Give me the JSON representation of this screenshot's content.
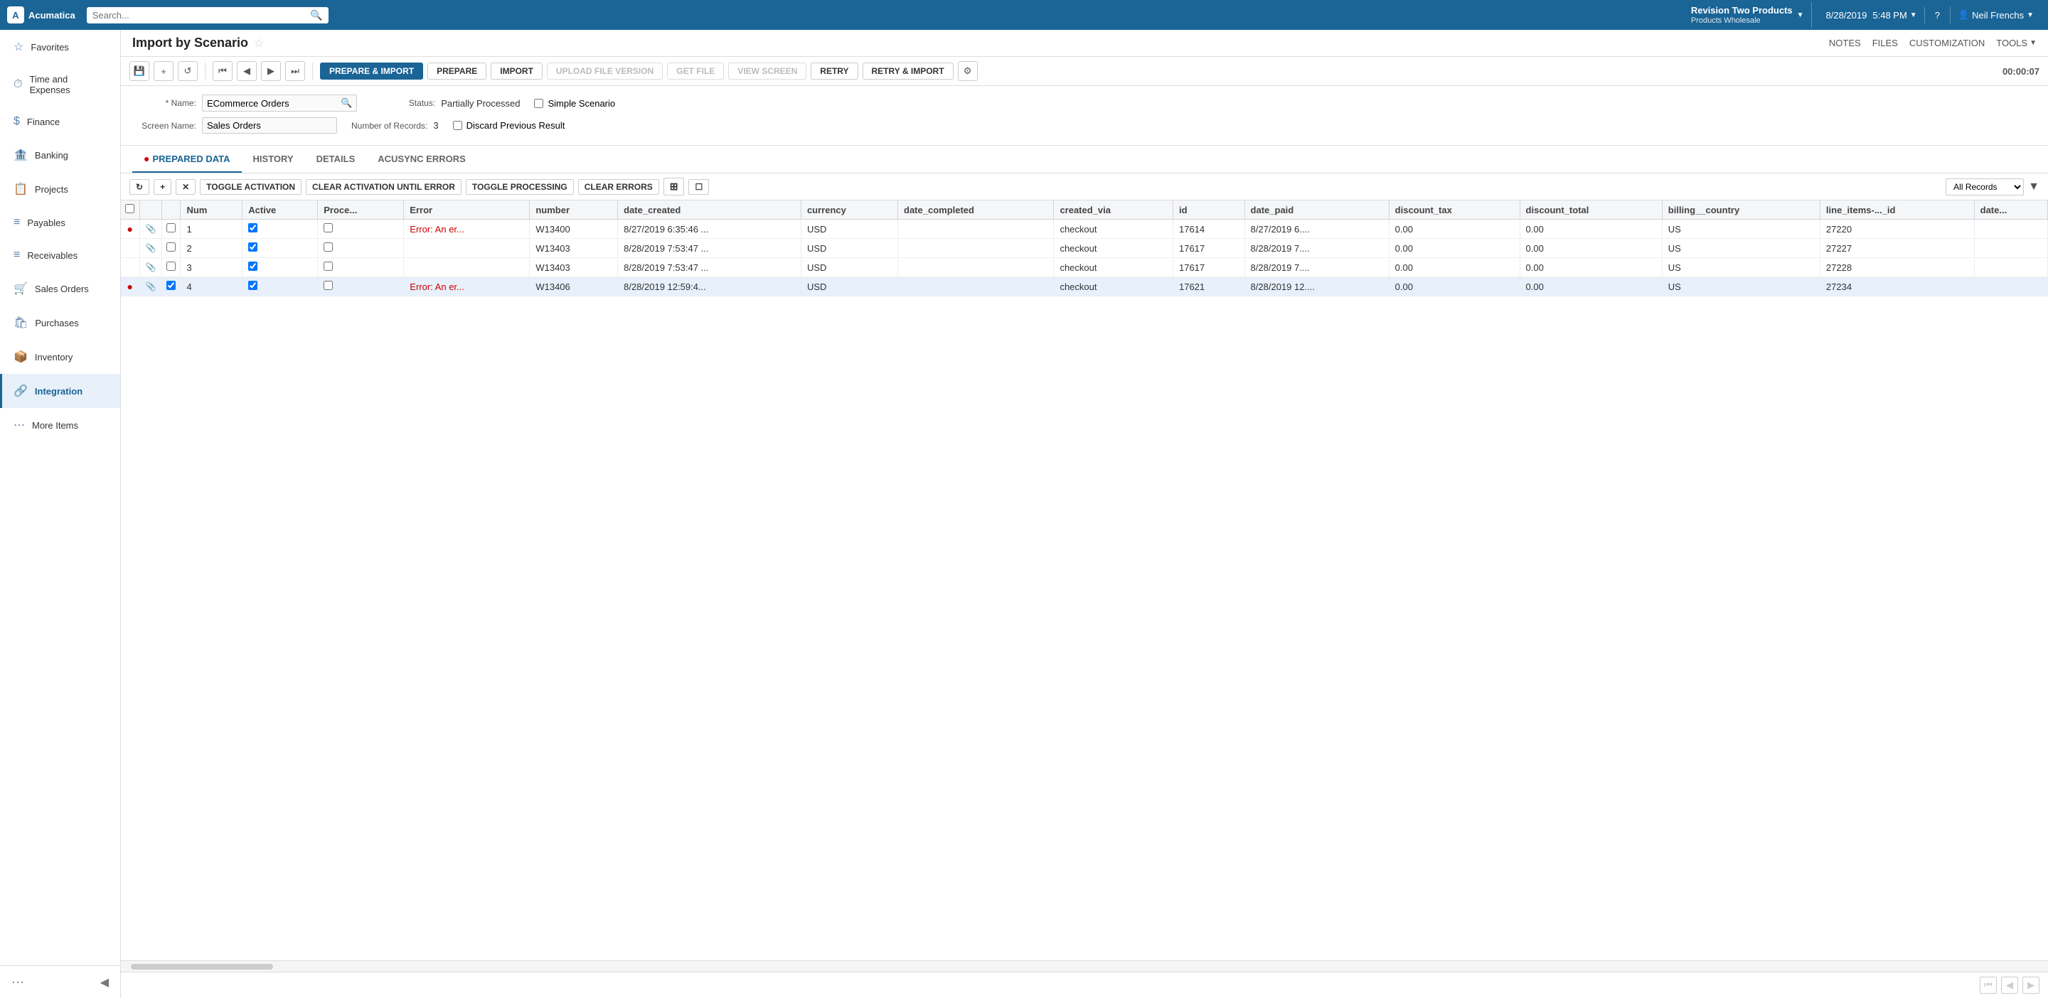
{
  "app": {
    "logo_text": "Acumatica",
    "logo_letter": "A"
  },
  "topnav": {
    "search_placeholder": "Search...",
    "company_name": "Revision Two Products",
    "company_sub": "Products Wholesale",
    "datetime": "8/28/2019",
    "time": "5:48 PM",
    "help_label": "?",
    "user_name": "Neil Frenchs"
  },
  "sidebar": {
    "items": [
      {
        "id": "favorites",
        "label": "Favorites",
        "icon": "☆"
      },
      {
        "id": "time-expenses",
        "label": "Time and Expenses",
        "icon": "⏱"
      },
      {
        "id": "finance",
        "label": "Finance",
        "icon": "$"
      },
      {
        "id": "banking",
        "label": "Banking",
        "icon": "🏦"
      },
      {
        "id": "projects",
        "label": "Projects",
        "icon": "📋"
      },
      {
        "id": "payables",
        "label": "Payables",
        "icon": "≡"
      },
      {
        "id": "receivables",
        "label": "Receivables",
        "icon": "≡"
      },
      {
        "id": "sales-orders",
        "label": "Sales Orders",
        "icon": "🛒"
      },
      {
        "id": "purchases",
        "label": "Purchases",
        "icon": "🛍"
      },
      {
        "id": "inventory",
        "label": "Inventory",
        "icon": "📦"
      },
      {
        "id": "integration",
        "label": "Integration",
        "icon": "🔗"
      },
      {
        "id": "more-items",
        "label": "More Items",
        "icon": "⋯"
      }
    ]
  },
  "page": {
    "title": "Import by Scenario",
    "actions": {
      "notes": "NOTES",
      "files": "FILES",
      "customization": "CUSTOMIZATION",
      "tools": "TOOLS"
    }
  },
  "toolbar": {
    "save_icon": "💾",
    "add_label": "+",
    "undo_label": "↺",
    "first_label": "⏮",
    "prev_label": "◀",
    "next_label": "▶",
    "last_label": "⏭",
    "prepare_import": "PREPARE & IMPORT",
    "prepare": "PREPARE",
    "import_label": "IMPORT",
    "upload_file_version": "UPLOAD FILE VERSION",
    "get_file": "GET FILE",
    "view_screen": "VIEW SCREEN",
    "retry": "RETRY",
    "retry_import": "RETRY & IMPORT",
    "settings_icon": "⚙",
    "timer": "00:00:07"
  },
  "form": {
    "name_label": "* Name:",
    "name_value": "ECommerce Orders",
    "screen_name_label": "Screen Name:",
    "screen_name_value": "Sales Orders",
    "status_label": "Status:",
    "status_value": "Partially Processed",
    "num_records_label": "Number of Records:",
    "num_records_value": "3",
    "simple_scenario_label": "Simple Scenario",
    "discard_prev_label": "Discard Previous Result"
  },
  "tabs": [
    {
      "id": "prepared-data",
      "label": "PREPARED DATA",
      "active": true,
      "has_error": true
    },
    {
      "id": "history",
      "label": "HISTORY",
      "active": false,
      "has_error": false
    },
    {
      "id": "details",
      "label": "DETAILS",
      "active": false,
      "has_error": false
    },
    {
      "id": "acusync-errors",
      "label": "ACUSYNC ERRORS",
      "active": false,
      "has_error": false
    }
  ],
  "table_toolbar": {
    "refresh": "↻",
    "add": "+",
    "delete": "✕",
    "toggle_activation": "TOGGLE ACTIVATION",
    "clear_activation": "CLEAR ACTIVATION UNTIL ERROR",
    "toggle_processing": "TOGGLE PROCESSING",
    "clear_errors": "CLEAR ERRORS",
    "fit_cols": "⊞",
    "select_icon": "☐",
    "all_records": "All Records",
    "filter_icon": "▼"
  },
  "table": {
    "columns": [
      {
        "id": "error-col",
        "label": ""
      },
      {
        "id": "attach-col",
        "label": ""
      },
      {
        "id": "check-col",
        "label": ""
      },
      {
        "id": "num",
        "label": "Num"
      },
      {
        "id": "active",
        "label": "Active"
      },
      {
        "id": "proce",
        "label": "Proce..."
      },
      {
        "id": "error",
        "label": "Error"
      },
      {
        "id": "number",
        "label": "number"
      },
      {
        "id": "date_created",
        "label": "date_created"
      },
      {
        "id": "currency",
        "label": "currency"
      },
      {
        "id": "date_completed",
        "label": "date_completed"
      },
      {
        "id": "created_via",
        "label": "created_via"
      },
      {
        "id": "id",
        "label": "id"
      },
      {
        "id": "date_paid",
        "label": "date_paid"
      },
      {
        "id": "discount_tax",
        "label": "discount_tax"
      },
      {
        "id": "discount_total",
        "label": "discount_total"
      },
      {
        "id": "billing_country",
        "label": "billing__country"
      },
      {
        "id": "line_items_id",
        "label": "line_items-..._id"
      },
      {
        "id": "date_more",
        "label": "date..."
      }
    ],
    "rows": [
      {
        "has_error": true,
        "num": "1",
        "active": true,
        "proce": false,
        "error": "Error: An er...",
        "number": "W13400",
        "date_created": "8/27/2019 6:35:46 ...",
        "currency": "USD",
        "date_completed": "",
        "created_via": "checkout",
        "id": "17614",
        "date_paid": "8/27/2019 6....",
        "discount_tax": "0.00",
        "discount_total": "0.00",
        "billing_country": "US",
        "line_items_id": "27220",
        "selected": false
      },
      {
        "has_error": false,
        "num": "2",
        "active": true,
        "proce": false,
        "error": "",
        "number": "W13403",
        "date_created": "8/28/2019 7:53:47 ...",
        "currency": "USD",
        "date_completed": "",
        "created_via": "checkout",
        "id": "17617",
        "date_paid": "8/28/2019 7....",
        "discount_tax": "0.00",
        "discount_total": "0.00",
        "billing_country": "US",
        "line_items_id": "27227",
        "selected": false
      },
      {
        "has_error": false,
        "num": "3",
        "active": true,
        "proce": false,
        "error": "",
        "number": "W13403",
        "date_created": "8/28/2019 7:53:47 ...",
        "currency": "USD",
        "date_completed": "",
        "created_via": "checkout",
        "id": "17617",
        "date_paid": "8/28/2019 7....",
        "discount_tax": "0.00",
        "discount_total": "0.00",
        "billing_country": "US",
        "line_items_id": "27228",
        "selected": false
      },
      {
        "has_error": true,
        "num": "4",
        "active": true,
        "proce": false,
        "error": "Error: An er...",
        "number": "W13406",
        "date_created": "8/28/2019 12:59:4...",
        "currency": "USD",
        "date_completed": "",
        "created_via": "checkout",
        "id": "17621",
        "date_paid": "8/28/2019 12....",
        "discount_tax": "0.00",
        "discount_total": "0.00",
        "billing_country": "US",
        "line_items_id": "27234",
        "selected": true
      }
    ]
  }
}
